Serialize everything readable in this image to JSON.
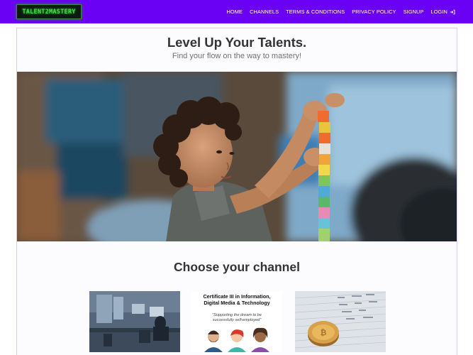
{
  "brand": {
    "logo_text": "TALENT2MASTERY"
  },
  "nav": {
    "items": [
      {
        "label": "HOME"
      },
      {
        "label": "CHANNELS"
      },
      {
        "label": "TERMS & CONDITIONS"
      },
      {
        "label": "PRIVACY POLICY"
      },
      {
        "label": "SIGNUP"
      },
      {
        "label": "LOGIN"
      }
    ],
    "login_icon": "login-arrow-icon"
  },
  "hero": {
    "title": "Level Up Your Talents.",
    "subtitle": "Find your flow on the way to mastery!",
    "image": "child-stacking-blocks-photo"
  },
  "channels": {
    "title": "Choose your channel",
    "tiles": [
      {
        "image": "office-workspace-photo"
      },
      {
        "heading_line1": "Certificate III in Information,",
        "heading_line2": "Digital Media & Technology",
        "quote_line1": "\"Supporting the dream to be",
        "quote_line2": "successfully self-employed\""
      },
      {
        "image": "bitcoin-coin-photo"
      }
    ]
  },
  "colors": {
    "nav_bg": "#6a00f4",
    "logo_green": "#3ee048",
    "card_border": "#d4cdef"
  }
}
